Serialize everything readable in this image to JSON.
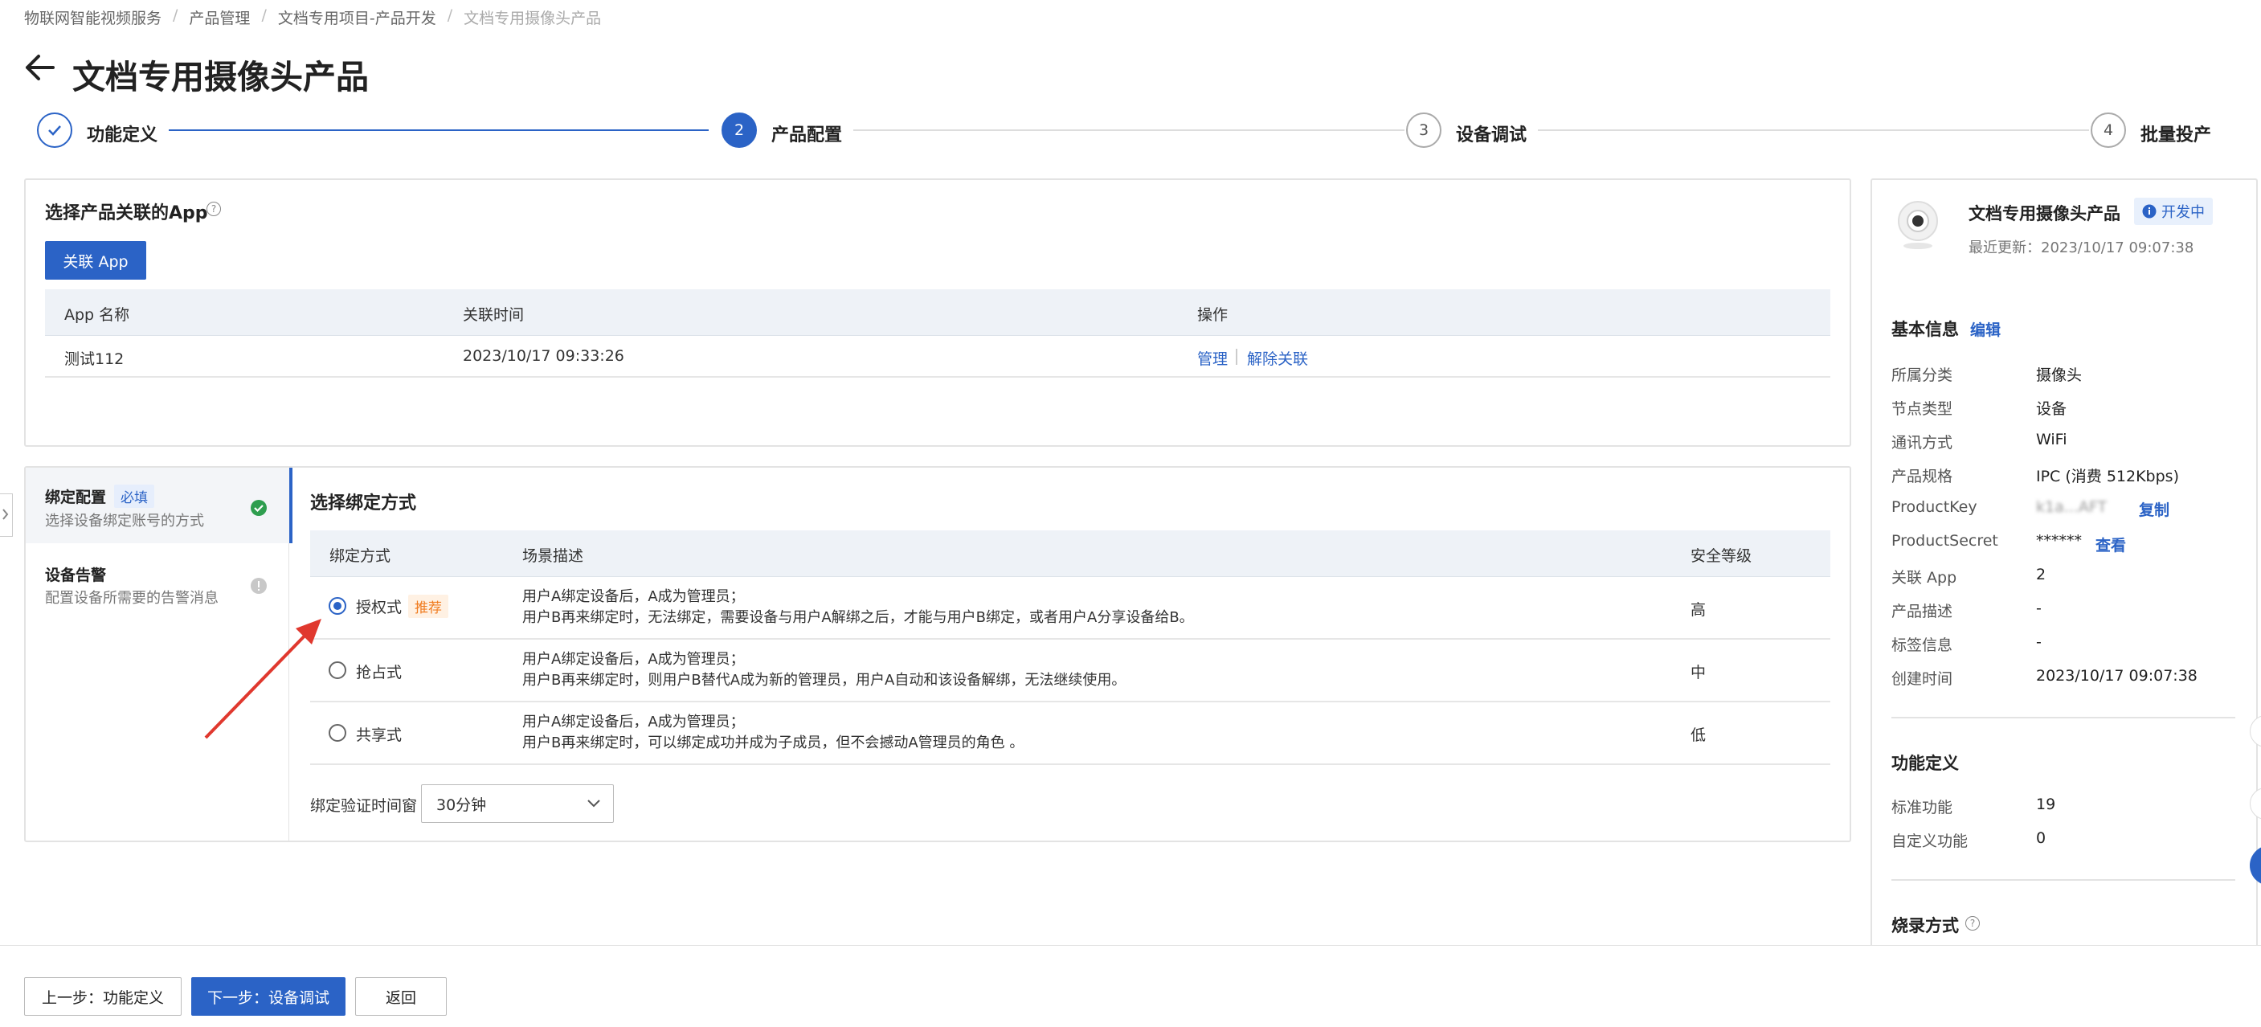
{
  "breadcrumb": [
    "物联网智能视频服务",
    "产品管理",
    "文档专用项目-产品开发",
    "文档专用摄像头产品"
  ],
  "page_title": "文档专用摄像头产品",
  "steps": [
    {
      "num": "✓",
      "label": "功能定义"
    },
    {
      "num": "2",
      "label": "产品配置"
    },
    {
      "num": "3",
      "label": "设备调试"
    },
    {
      "num": "4",
      "label": "批量投产"
    }
  ],
  "app_section": {
    "title": "选择产品关联的App",
    "button": "关联 App",
    "columns": [
      "App 名称",
      "关联时间",
      "操作"
    ],
    "rows": [
      {
        "name": "测试112",
        "time": "2023/10/17 09:33:26",
        "action_manage": "管理",
        "action_unbind": "解除关联"
      }
    ]
  },
  "side_nav": [
    {
      "title": "绑定配置",
      "tag": "必填",
      "desc": "选择设备绑定账号的方式",
      "status": "ok"
    },
    {
      "title": "设备告警",
      "tag": "",
      "desc": "配置设备所需要的告警消息",
      "status": "info"
    }
  ],
  "binding": {
    "title": "选择绑定方式",
    "columns": [
      "绑定方式",
      "场景描述",
      "安全等级"
    ],
    "rows": [
      {
        "mode": "授权式",
        "tag": "推荐",
        "checked": true,
        "desc1": "用户A绑定设备后，A成为管理员；",
        "desc2": "用户B再来绑定时，无法绑定，需要设备与用户A解绑之后，才能与用户B绑定，或者用户A分享设备给B。",
        "level": "高"
      },
      {
        "mode": "抢占式",
        "tag": "",
        "checked": false,
        "desc1": "用户A绑定设备后，A成为管理员；",
        "desc2": "用户B再来绑定时，则用户B替代A成为新的管理员，用户A自动和该设备解绑，无法继续使用。",
        "level": "中"
      },
      {
        "mode": "共享式",
        "tag": "",
        "checked": false,
        "desc1": "用户A绑定设备后，A成为管理员；",
        "desc2": "用户B再来绑定时，可以绑定成功并成为子成员，但不会撼动A管理员的角色 。",
        "level": "低"
      }
    ],
    "window_label": "绑定验证时间窗",
    "window_value": "30分钟"
  },
  "product_card": {
    "name": "文档专用摄像头产品",
    "status": "开发中",
    "updated": "最近更新：2023/10/17 09:07:38"
  },
  "basic_info": {
    "title": "基本信息",
    "edit": "编辑",
    "items": [
      {
        "label": "所属分类",
        "value": "摄像头"
      },
      {
        "label": "节点类型",
        "value": "设备"
      },
      {
        "label": "通讯方式",
        "value": "WiFi"
      },
      {
        "label": "产品规格",
        "value": "IPC (消费 512Kbps)"
      },
      {
        "label": "ProductKey",
        "value": "k1a...AFT",
        "action": "复制"
      },
      {
        "label": "ProductSecret",
        "value": "******",
        "action": "查看"
      },
      {
        "label": "关联 App",
        "value": "2"
      },
      {
        "label": "产品描述",
        "value": "-"
      },
      {
        "label": "标签信息",
        "value": "-"
      },
      {
        "label": "创建时间",
        "value": "2023/10/17 09:07:38"
      }
    ]
  },
  "func_def": {
    "title": "功能定义",
    "items": [
      {
        "label": "标准功能",
        "value": "19"
      },
      {
        "label": "自定义功能",
        "value": "0"
      }
    ]
  },
  "burn": {
    "title": "烧录方式"
  },
  "footer": {
    "prev": "上一步：功能定义",
    "next": "下一步：设备调试",
    "back": "返回"
  }
}
